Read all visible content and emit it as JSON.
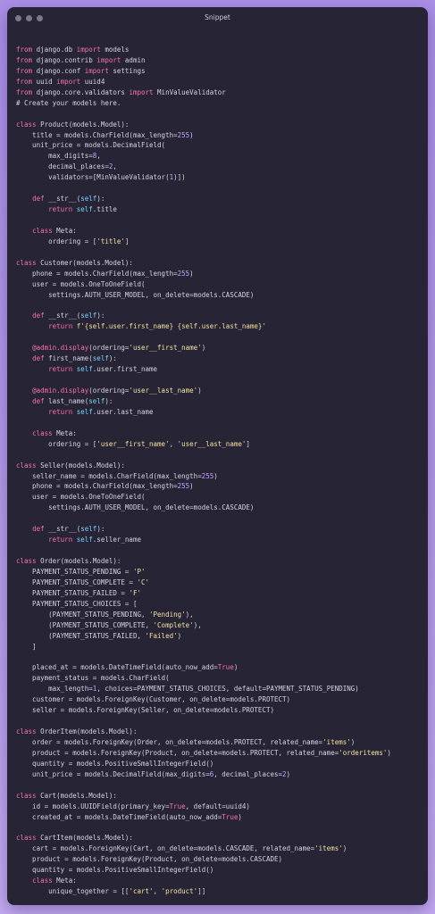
{
  "window": {
    "title": "Snippet",
    "controls": [
      "close",
      "minimize",
      "maximize"
    ]
  },
  "code": {
    "language": "python",
    "lines": [
      "from django.db import models",
      "from django.contrib import admin",
      "from django.conf import settings",
      "from uuid import uuid4",
      "from django.core.validators import MinValueValidator",
      "# Create your models here.",
      "",
      "class Product(models.Model):",
      "    title = models.CharField(max_length=255)",
      "    unit_price = models.DecimalField(",
      "        max_digits=8,",
      "        decimal_places=2,",
      "        validators=[MinValueValidator(1)])",
      "",
      "    def __str__(self):",
      "        return self.title",
      "",
      "    class Meta:",
      "        ordering = ['title']",
      "",
      "class Customer(models.Model):",
      "    phone = models.CharField(max_length=255)",
      "    user = models.OneToOneField(",
      "        settings.AUTH_USER_MODEL, on_delete=models.CASCADE)",
      "",
      "    def __str__(self):",
      "        return f'{self.user.first_name} {self.user.last_name}'",
      "",
      "    @admin.display(ordering='user__first_name')",
      "    def first_name(self):",
      "        return self.user.first_name",
      "",
      "    @admin.display(ordering='user__last_name')",
      "    def last_name(self):",
      "        return self.user.last_name",
      "",
      "    class Meta:",
      "        ordering = ['user__first_name', 'user__last_name']",
      "",
      "class Seller(models.Model):",
      "    seller_name = models.CharField(max_length=255)",
      "    phone = models.CharField(max_length=255)",
      "    user = models.OneToOneField(",
      "        settings.AUTH_USER_MODEL, on_delete=models.CASCADE)",
      "",
      "    def __str__(self):",
      "        return self.seller_name",
      "",
      "class Order(models.Model):",
      "    PAYMENT_STATUS_PENDING = 'P'",
      "    PAYMENT_STATUS_COMPLETE = 'C'",
      "    PAYMENT_STATUS_FAILED = 'F'",
      "    PAYMENT_STATUS_CHOICES = [",
      "        (PAYMENT_STATUS_PENDING, 'Pending'),",
      "        (PAYMENT_STATUS_COMPLETE, 'Complete'),",
      "        (PAYMENT_STATUS_FAILED, 'Failed')",
      "    ]",
      "",
      "    placed_at = models.DateTimeField(auto_now_add=True)",
      "    payment_status = models.CharField(",
      "        max_length=1, choices=PAYMENT_STATUS_CHOICES, default=PAYMENT_STATUS_PENDING)",
      "    customer = models.ForeignKey(Customer, on_delete=models.PROTECT)",
      "    seller = models.ForeignKey(Seller, on_delete=models.PROTECT)",
      "",
      "class OrderItem(models.Model):",
      "    order = models.ForeignKey(Order, on_delete=models.PROTECT, related_name='items')",
      "    product = models.ForeignKey(Product, on_delete=models.PROTECT, related_name='orderitems')",
      "    quantity = models.PositiveSmallIntegerField()",
      "    unit_price = models.DecimalField(max_digits=6, decimal_places=2)",
      "",
      "class Cart(models.Model):",
      "    id = models.UUIDField(primary_key=True, default=uuid4)",
      "    created_at = models.DateTimeField(auto_now_add=True)",
      "",
      "class CartItem(models.Model):",
      "    cart = models.ForeignKey(Cart, on_delete=models.CASCADE, related_name='items')",
      "    product = models.ForeignKey(Product, on_delete=models.CASCADE)",
      "    quantity = models.PositiveSmallIntegerField()",
      "    class Meta:",
      "        unique_together = [['cart', 'product']]"
    ]
  },
  "colors": {
    "background": "#b39be8",
    "window": "#262435",
    "text": "#d6d3e4",
    "keyword": "#f472b6",
    "string": "#f5e1a4",
    "number": "#c4a5ff",
    "function": "#7dd3fc"
  }
}
